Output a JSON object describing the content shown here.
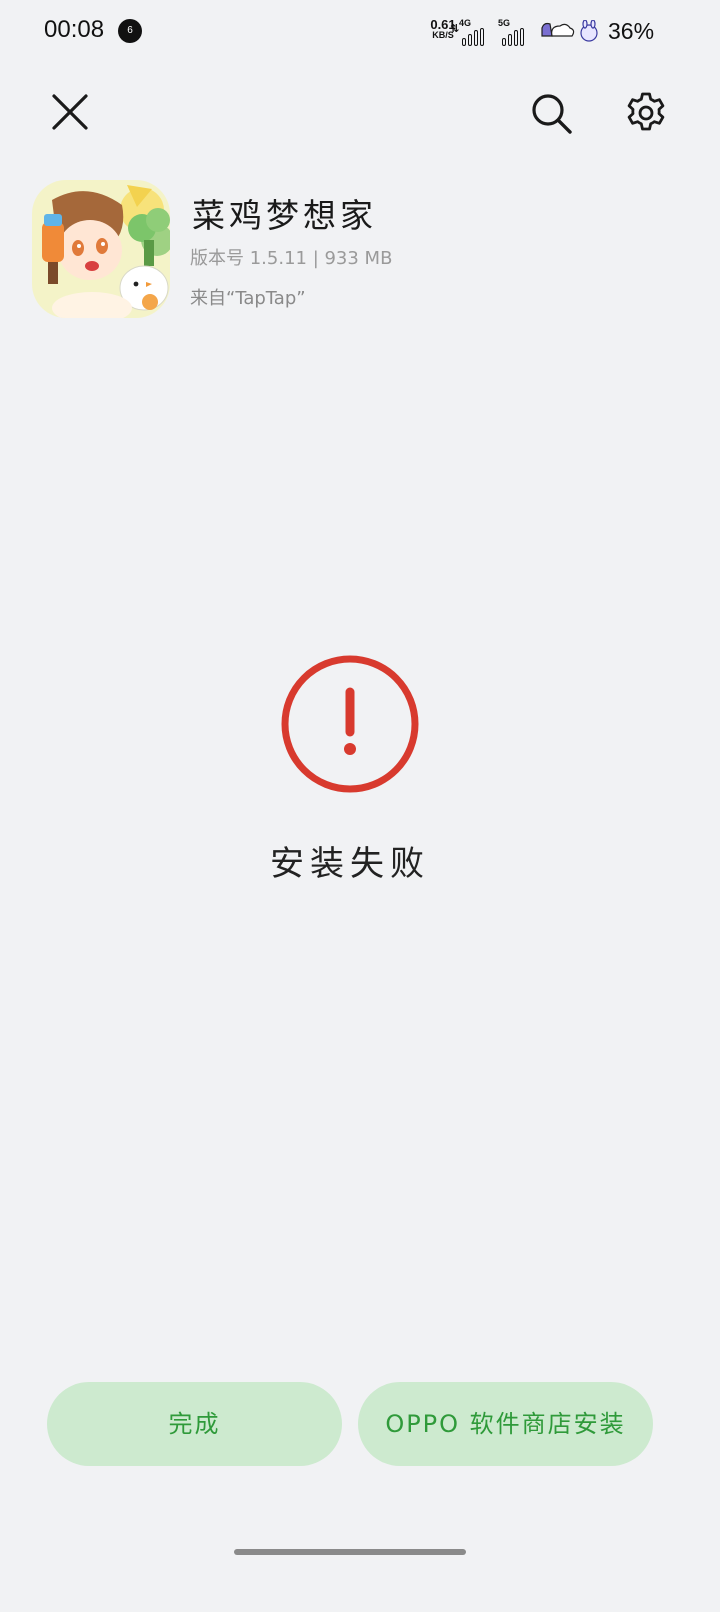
{
  "status_bar": {
    "time": "00:08",
    "notification_badge": "6",
    "net_speed_value": "0.61",
    "net_speed_unit": "KB/S",
    "signal1_label": "4G",
    "signal2_label": "5G",
    "battery": "36%"
  },
  "toolbar": {
    "close_icon": "close-icon",
    "search_icon": "search-icon",
    "settings_icon": "gear-icon"
  },
  "app": {
    "name": "菜鸡梦想家",
    "version_line": "版本号 1.5.11 | 933 MB",
    "source_line": "来自“TapTap”"
  },
  "result": {
    "icon": "error-icon",
    "color": "#d83a2e",
    "message": "安装失败"
  },
  "actions": {
    "done_label": "完成",
    "store_install_label": "OPPO 软件商店安装",
    "button_bg": "#cdeacf",
    "button_text_color": "#2f9a3a"
  }
}
